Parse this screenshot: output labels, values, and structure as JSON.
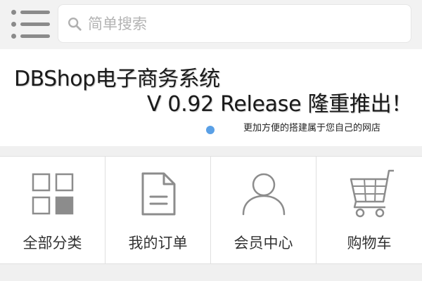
{
  "header": {
    "menu_icon": "menu-list-icon",
    "search": {
      "placeholder": "简单搜索",
      "value": "",
      "icon": "search-icon"
    }
  },
  "banner": {
    "title": "DBShop电子商务系统",
    "version": "V 0.92 Release 隆重推出！",
    "subtitle": "更加方便的搭建属于您自己的网店",
    "indicator_color": "#5aa0e6"
  },
  "nav": {
    "items": [
      {
        "label": "全部分类",
        "icon": "category-grid-icon"
      },
      {
        "label": "我的订单",
        "icon": "order-document-icon"
      },
      {
        "label": "会员中心",
        "icon": "user-profile-icon"
      },
      {
        "label": "购物车",
        "icon": "shopping-cart-icon"
      }
    ]
  }
}
